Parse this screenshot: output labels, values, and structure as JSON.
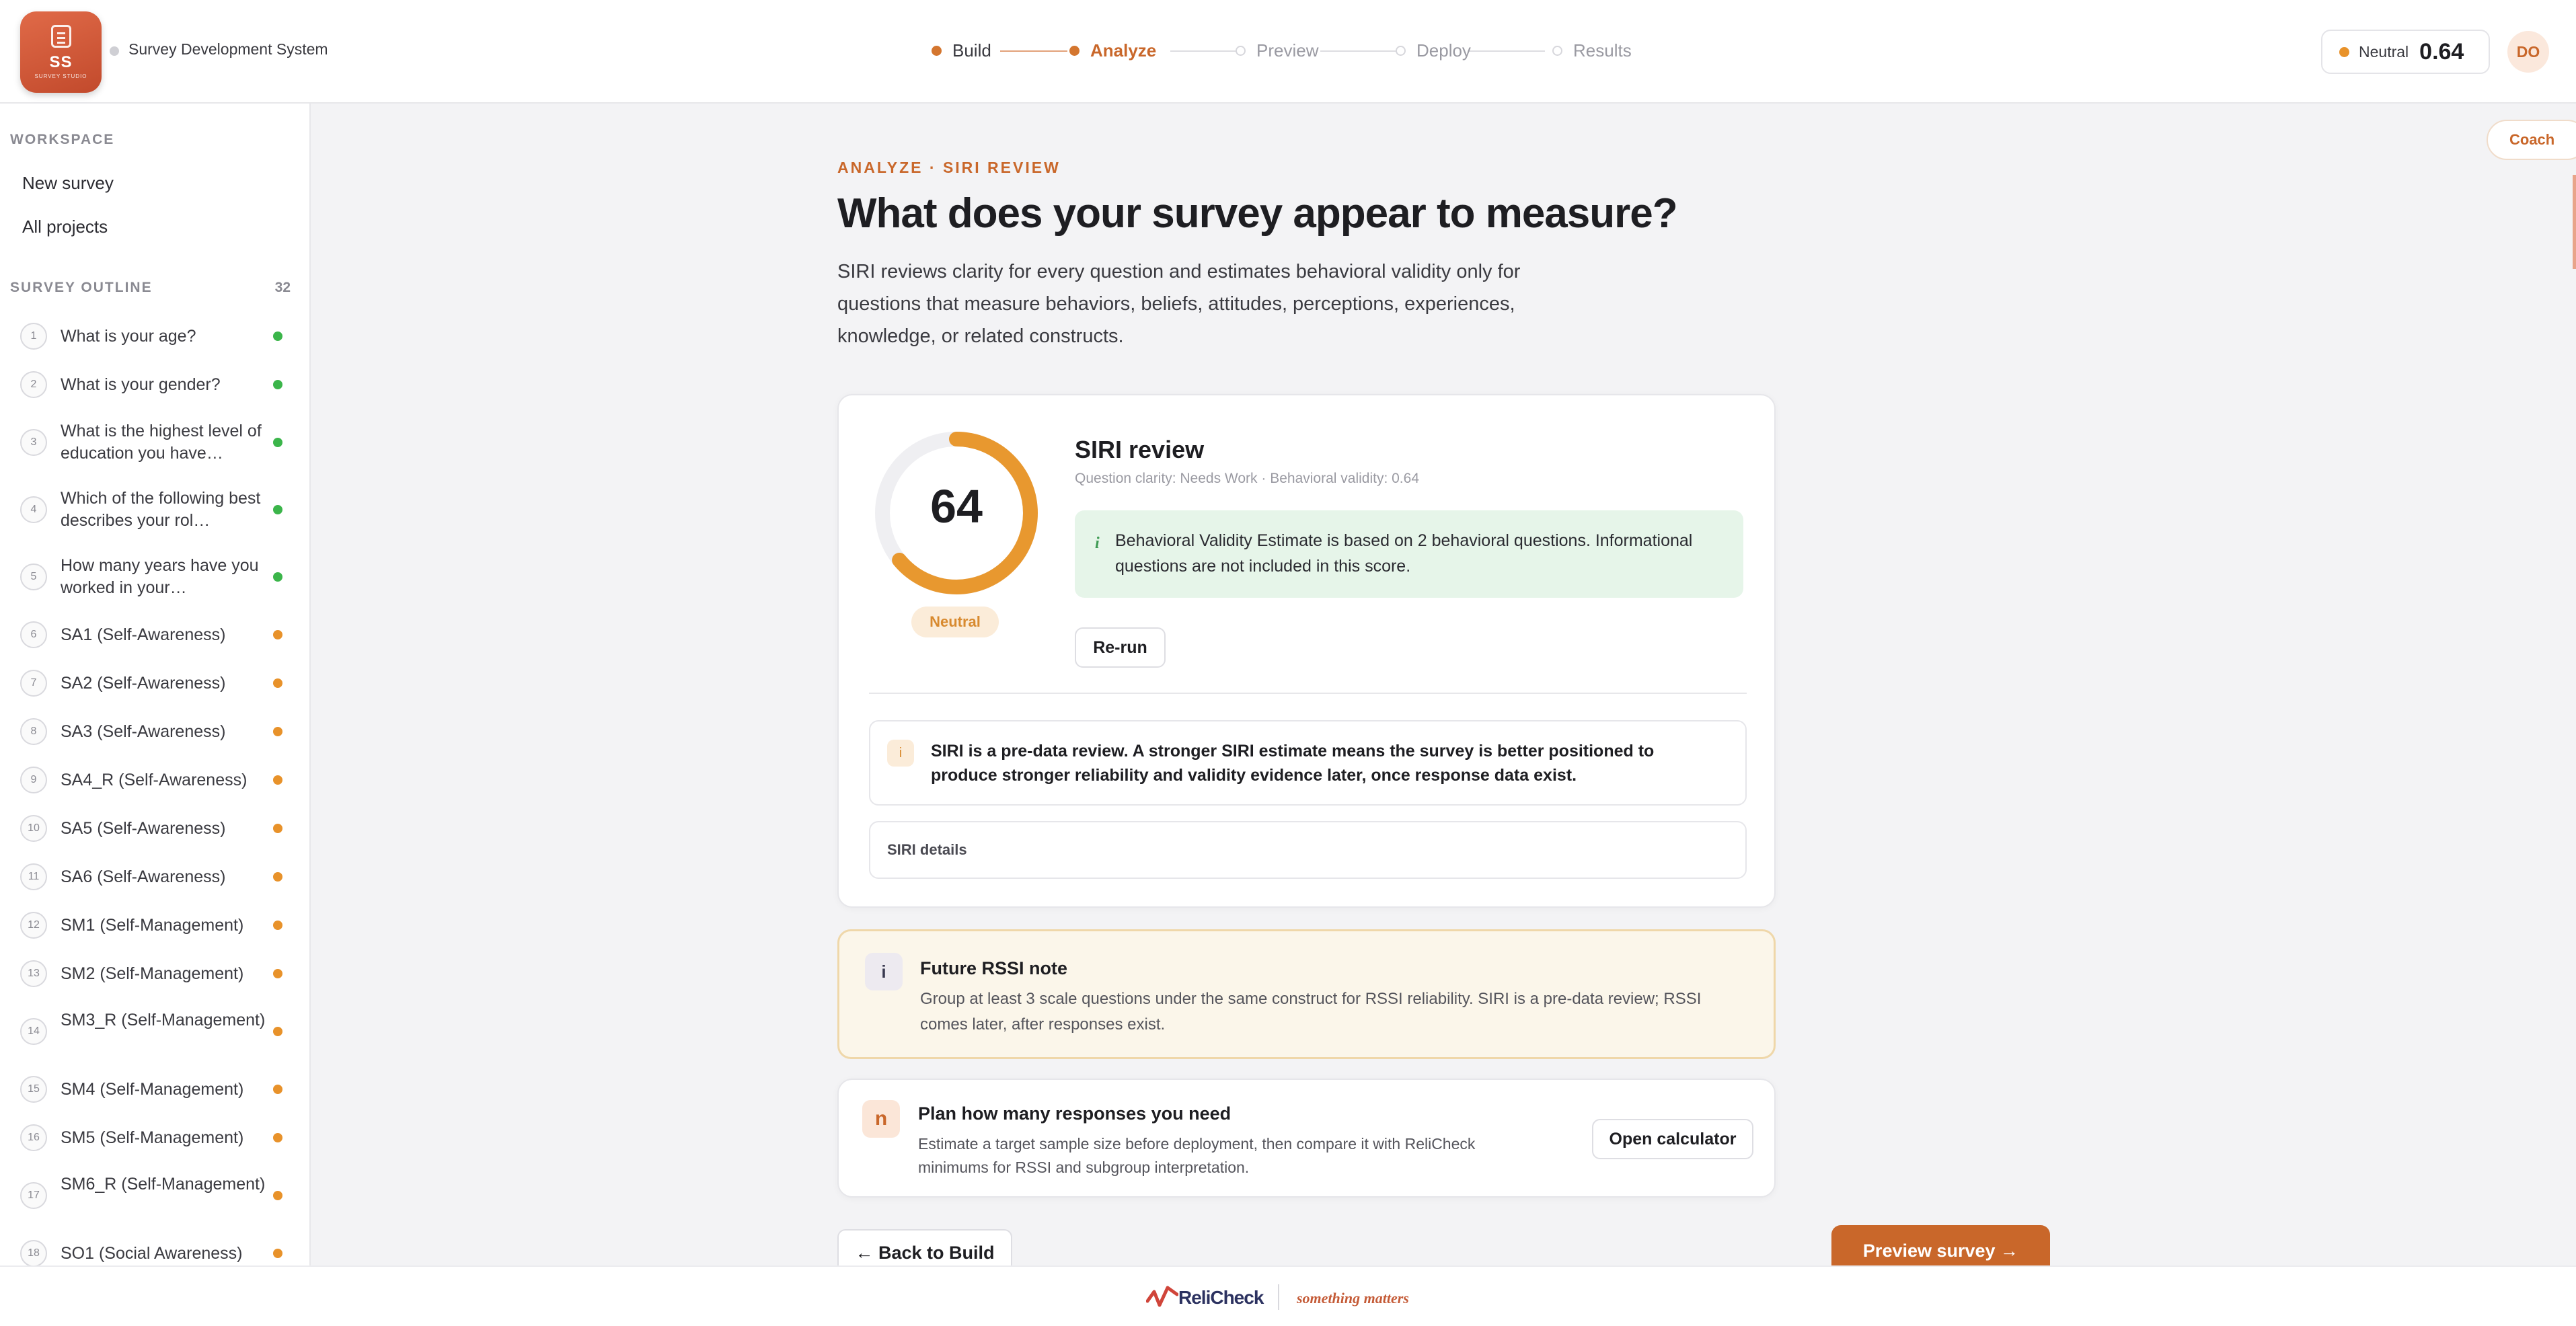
{
  "app": {
    "logo_initials": "SS",
    "logo_subtitle": "SURVEY STUDIO",
    "title": "Survey Development System"
  },
  "steps": [
    {
      "label": "Build",
      "state": "done"
    },
    {
      "label": "Analyze",
      "state": "active"
    },
    {
      "label": "Preview",
      "state": "upcoming"
    },
    {
      "label": "Deploy",
      "state": "upcoming"
    },
    {
      "label": "Results",
      "state": "upcoming"
    }
  ],
  "score_pill": {
    "label": "Neutral",
    "value": "0.64"
  },
  "avatar": "DO",
  "sidebar": {
    "workspace_heading": "WORKSPACE",
    "links": [
      "New survey",
      "All projects"
    ],
    "outline_heading": "SURVEY OUTLINE",
    "outline_count": "32",
    "questions": [
      {
        "num": "1",
        "text": "What is your age?",
        "status": "green"
      },
      {
        "num": "2",
        "text": "What is your gender?",
        "status": "green"
      },
      {
        "num": "3",
        "text": "What is the highest level of education you have…",
        "status": "green"
      },
      {
        "num": "4",
        "text": "Which of the following best describes your rol…",
        "status": "green"
      },
      {
        "num": "5",
        "text": "How many years have you worked in your…",
        "status": "green"
      },
      {
        "num": "6",
        "text": "SA1 (Self-Awareness)",
        "status": "orange"
      },
      {
        "num": "7",
        "text": "SA2 (Self-Awareness)",
        "status": "orange"
      },
      {
        "num": "8",
        "text": "SA3 (Self-Awareness)",
        "status": "orange"
      },
      {
        "num": "9",
        "text": "SA4_R (Self-Awareness)",
        "status": "orange"
      },
      {
        "num": "10",
        "text": "SA5 (Self-Awareness)",
        "status": "orange"
      },
      {
        "num": "11",
        "text": "SA6 (Self-Awareness)",
        "status": "orange"
      },
      {
        "num": "12",
        "text": "SM1 (Self-Management)",
        "status": "orange"
      },
      {
        "num": "13",
        "text": "SM2 (Self-Management)",
        "status": "orange"
      },
      {
        "num": "14",
        "text": "SM3_R (Self-Management)",
        "status": "orange"
      },
      {
        "num": "15",
        "text": "SM4 (Self-Management)",
        "status": "orange"
      },
      {
        "num": "16",
        "text": "SM5 (Self-Management)",
        "status": "orange"
      },
      {
        "num": "17",
        "text": "SM6_R (Self-Management)",
        "status": "orange"
      },
      {
        "num": "18",
        "text": "SO1 (Social Awareness)",
        "status": "orange"
      }
    ]
  },
  "main": {
    "eyebrow": "ANALYZE · SIRI REVIEW",
    "title": "What does your survey appear to measure?",
    "description": "SIRI reviews clarity for every question and estimates behavioral validity only for questions that measure behaviors, beliefs, attitudes, perceptions, experiences, knowledge, or related constructs."
  },
  "siri": {
    "score": "64",
    "score_fraction": 0.64,
    "badge": "Neutral",
    "title": "SIRI review",
    "subtitle": "Question clarity: Needs Work · Behavioral validity: 0.64",
    "info_icon": "i",
    "info": "Behavioral Validity Estimate is based on 2 behavioral questions. Informational questions are not included in this score.",
    "rerun_label": "Re-run",
    "note_icon": "i",
    "note": "SIRI is a pre-data review. A stronger SIRI estimate means the survey is better positioned to produce stronger reliability and validity evidence later, once response data exist.",
    "details_label": "SIRI details"
  },
  "rssi": {
    "icon": "i",
    "title": "Future RSSI note",
    "text": "Group at least 3 scale questions under the same construct for RSSI reliability. SIRI is a pre-data review; RSSI comes later, after responses exist."
  },
  "plan": {
    "icon": "n",
    "title": "Plan how many responses you need",
    "text": "Estimate a target sample size before deployment, then compare it with ReliCheck minimums for RSSI and subgroup interpretation.",
    "button": "Open calculator"
  },
  "nav": {
    "back": "← Back to Build",
    "next": "Preview survey →"
  },
  "coach": "Coach",
  "footer": {
    "brand": "ReliCheck",
    "tagline": "something matters"
  },
  "colors": {
    "accent": "#c9672a",
    "gauge": "#e8982f",
    "status_green": "#3bb54a",
    "status_orange": "#e8922a"
  }
}
